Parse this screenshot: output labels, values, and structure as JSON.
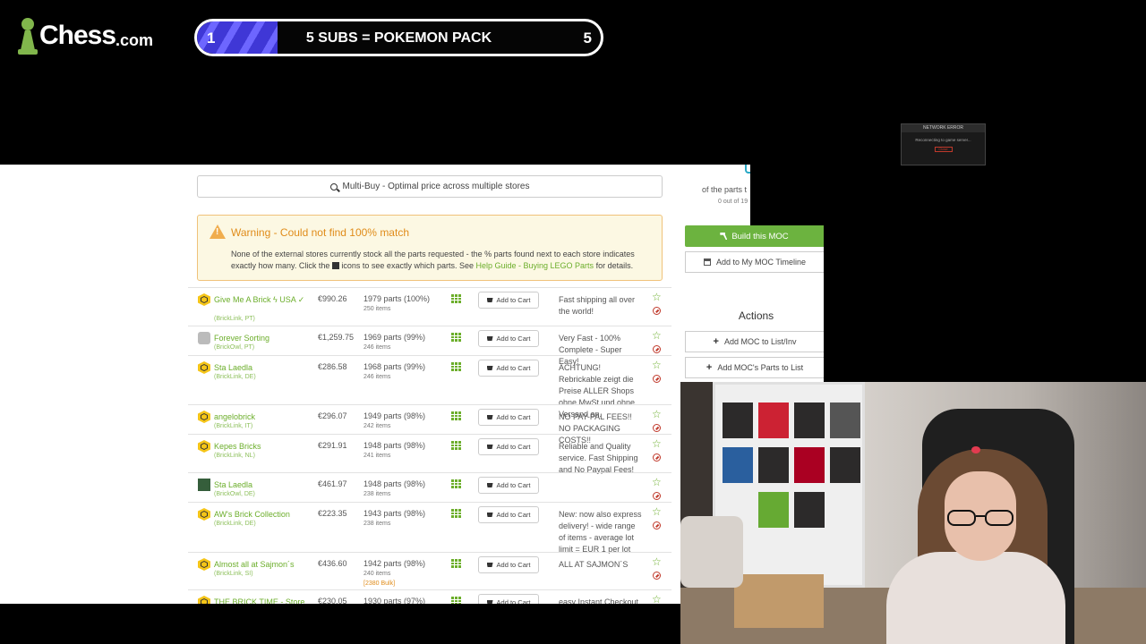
{
  "overlay": {
    "logo_word": "Chess",
    "logo_suffix": ".com",
    "sub_goal": {
      "current": "1",
      "text": "5 SUBS = POKEMON PACK",
      "target": "5",
      "progress": 0.2
    }
  },
  "page": {
    "multibuy_label": "Multi-Buy - Optimal price across multiple stores",
    "warning": {
      "title": "Warning - Could not find 100% match",
      "body_1": "None of the external stores currently stock all the parts requested - the % parts found next to each store indicates exactly how many. Click the",
      "body_2": "icons to see exactly which parts. See",
      "link": "Help Guide - Buying LEGO Parts",
      "body_3": "for details."
    },
    "cart_label": "Add to Cart",
    "stores": [
      {
        "name": "Give Me A Brick ϟ USA ✓",
        "source": "(BrickLink, PT)",
        "price": "€990.26",
        "parts": "1979 parts (100%)",
        "items": "250 items",
        "bulk": "",
        "note": "Fast shipping all over the world!",
        "badge": "hex"
      },
      {
        "name": "Forever Sorting",
        "source": "(BrickOwl, PT)",
        "price": "€1,259.75",
        "parts": "1969 parts (99%)",
        "items": "246 items",
        "bulk": "",
        "note": "Very Fast - 100% Complete - Super Easy!",
        "badge": "owl"
      },
      {
        "name": "Sta Laedla",
        "source": "(BrickLink, DE)",
        "price": "€286.58",
        "parts": "1968 parts (99%)",
        "items": "246 items",
        "bulk": "",
        "note": "ACHTUNG! Rebrickable zeigt die Preise ALLER Shops ohne MwSt und ohne Versand an.",
        "badge": "hex"
      },
      {
        "name": "angelobrick",
        "source": "(BrickLink, IT)",
        "price": "€296.07",
        "parts": "1949 parts (98%)",
        "items": "242 items",
        "bulk": "",
        "note": "NO PAY-PAL FEES!! NO PACKAGING COSTS!!",
        "badge": "hex"
      },
      {
        "name": "Kepes Bricks",
        "source": "(BrickLink, NL)",
        "price": "€291.91",
        "parts": "1948 parts (98%)",
        "items": "241 items",
        "bulk": "",
        "note": "Reliable and Quality service. Fast Shipping and No Paypal Fees!",
        "badge": "hex"
      },
      {
        "name": "Sta Laedla",
        "source": "(BrickOwl, DE)",
        "price": "€461.97",
        "parts": "1948 parts (98%)",
        "items": "238 items",
        "bulk": "",
        "note": "",
        "badge": "sq"
      },
      {
        "name": "AW's Brick Collection",
        "source": "(BrickLink, DE)",
        "price": "€223.35",
        "parts": "1943 parts (98%)",
        "items": "238 items",
        "bulk": "",
        "note": "New: now also express delivery! - wide range of items - average lot limit = EUR 1 per lot",
        "badge": "hex"
      },
      {
        "name": "Almost all at Sajmon´s",
        "source": "(BrickLink, SI)",
        "price": "€436.60",
        "parts": "1942 parts (98%)",
        "items": "240 items",
        "bulk": "[2380 Bulk]",
        "note": "ALL AT SAJMON´S",
        "badge": "hex"
      },
      {
        "name": "THE BRICK TIME - Store",
        "source": "",
        "price": "€230.05",
        "parts": "1930 parts (97%)",
        "items": "",
        "bulk": "",
        "note": "easy Instant Checkout",
        "badge": "hex"
      }
    ],
    "sidebar": {
      "stat_label": "of the parts t",
      "stat_sub": "0 out of 19",
      "build_label": "Build this MOC",
      "timeline_label": "Add to My MOC Timeline",
      "actions_title": "Actions",
      "add_list_label": "Add MOC to List/Inv",
      "add_parts_label": "Add MOC's Parts to List"
    }
  },
  "mini_window": {
    "title": "NETWORK ERROR",
    "text": "Reconnecting to game server...",
    "button": "Close"
  },
  "colors": {
    "accent": "#6cae2b",
    "warning": "#e08c1a",
    "sub_bar": "#3f37d6"
  }
}
